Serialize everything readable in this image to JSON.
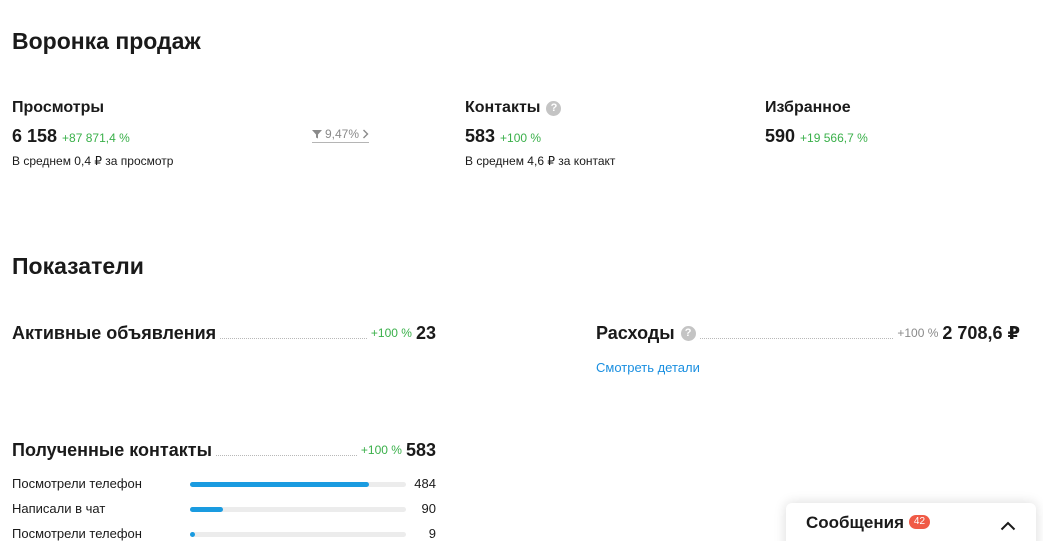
{
  "funnel": {
    "title": "Воронка продаж",
    "views": {
      "label": "Просмотры",
      "value": "6 158",
      "delta": "+87 871,4 %",
      "sub": "В среднем 0,4 ₽ за просмотр"
    },
    "conversion": {
      "value": "9,47%",
      "icon": "funnel-icon"
    },
    "contacts": {
      "label": "Контакты",
      "value": "583",
      "delta": "+100 %",
      "sub": "В среднем 4,6 ₽ за контакт"
    },
    "favorites": {
      "label": "Избранное",
      "value": "590",
      "delta": "+19 566,7 %"
    }
  },
  "metrics": {
    "title": "Показатели",
    "active_ads": {
      "label": "Активные объявления",
      "delta": "+100 %",
      "value": "23"
    },
    "expenses": {
      "label": "Расходы",
      "delta": "+100 %",
      "value": "2 708,6 ₽",
      "details_link": "Смотреть детали"
    },
    "contacts": {
      "label": "Полученные контакты",
      "delta": "+100 %",
      "value": "583",
      "rows": [
        {
          "label": "Посмотрели телефон",
          "value": "484",
          "fraction": 0.83
        },
        {
          "label": "Написали в чат",
          "value": "90",
          "fraction": 0.155
        },
        {
          "label": "Посмотрели телефон",
          "value": "9",
          "fraction": 0.025
        }
      ]
    }
  },
  "chat": {
    "title": "Сообщения",
    "badge": "42"
  },
  "colors": {
    "accent": "#1a9be0",
    "positive": "#3ab04a",
    "badge": "#f05a46",
    "link": "#1a8fe0"
  }
}
